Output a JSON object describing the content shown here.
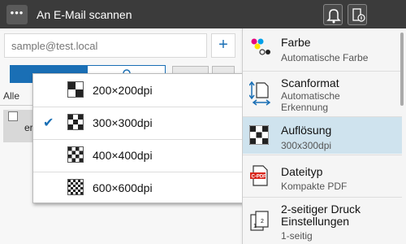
{
  "header": {
    "menu_icon": "ellipsis-icon",
    "title": "An E-Mail  scannen",
    "bell_icon": "bell-icon",
    "device_icon": "device-info-icon"
  },
  "left": {
    "search_placeholder": "sample@test.local",
    "add_label": "+",
    "filter_label": "Alle",
    "entry_text": "er"
  },
  "dropdown": {
    "selected": "300×300dpi",
    "items": [
      {
        "label": "200×200dpi",
        "selected": false
      },
      {
        "label": "300×300dpi",
        "selected": true
      },
      {
        "label": "400×400dpi",
        "selected": false
      },
      {
        "label": "600×600dpi",
        "selected": false
      }
    ]
  },
  "right": {
    "items": [
      {
        "title": "Farbe",
        "value": "Automatische  Farbe",
        "icon": "color-icon"
      },
      {
        "title": "Scanformat",
        "value": "Automatische\nErkennung",
        "icon": "scan-format-icon"
      },
      {
        "title": "Auflösung",
        "value": "300x300dpi",
        "icon": "resolution-icon",
        "selected": true
      },
      {
        "title": "Dateityp",
        "value": "Kompakte  PDF",
        "icon": "pdf-icon"
      },
      {
        "title": "2-seitiger  Druck\nEinstellungen",
        "value": "1-seitig",
        "icon": "duplex-icon"
      }
    ]
  },
  "colors": {
    "header_bg": "#3b3b3b",
    "accent": "#1a6fb5",
    "selected_bg": "#cfe3ee"
  }
}
